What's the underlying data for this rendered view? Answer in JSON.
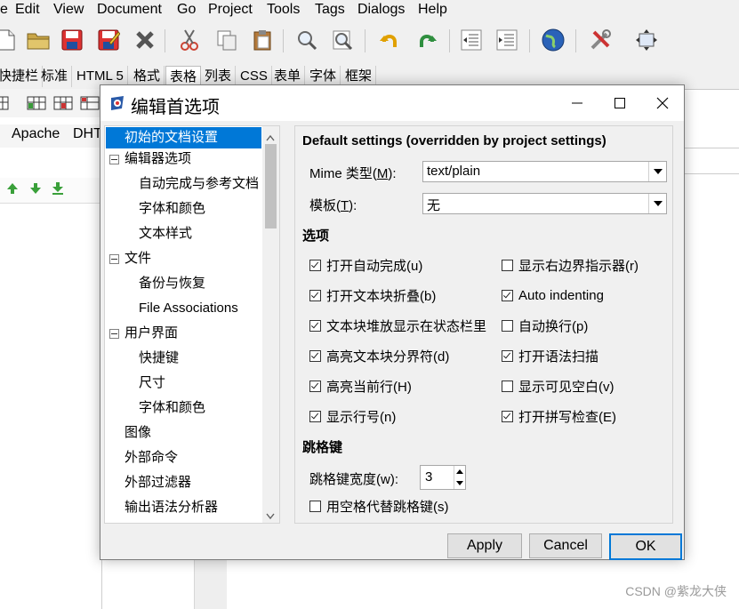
{
  "menubar": {
    "items": [
      "e",
      "Edit",
      "View",
      "Document",
      "Go",
      "Project",
      "Tools",
      "Tags",
      "Dialogs",
      "Help"
    ]
  },
  "toolbar_icons": [
    "new-file-icon",
    "open-folder-icon",
    "save-icon",
    "save-as-icon",
    "close-x-icon",
    "cut-icon",
    "copy-icon",
    "paste-icon",
    "find-icon",
    "find-replace-icon",
    "undo-icon",
    "redo-icon",
    "indent-left-icon",
    "indent-right-icon",
    "globe-preview-icon",
    "tools-icon",
    "fullscreen-icon"
  ],
  "app_tabs": [
    "快捷栏",
    "标准",
    "HTML 5",
    "格式",
    "表格",
    "列表",
    "CSS",
    "表单",
    "字体",
    "框架"
  ],
  "app_tab_active": 4,
  "app_strip_texts": [
    "Apache",
    "DHT"
  ],
  "dialog": {
    "title": "编辑首选项",
    "tree": [
      {
        "label": "初始的文档设置",
        "level": 0,
        "selected": true
      },
      {
        "label": "编辑器选项",
        "level": 0,
        "expander": true
      },
      {
        "label": "自动完成与参考文档",
        "level": 1
      },
      {
        "label": "字体和颜色",
        "level": 1
      },
      {
        "label": "文本样式",
        "level": 1
      },
      {
        "label": "文件",
        "level": 0,
        "expander": true
      },
      {
        "label": "备份与恢复",
        "level": 1
      },
      {
        "label": "File Associations",
        "level": 1
      },
      {
        "label": "用户界面",
        "level": 0,
        "expander": true
      },
      {
        "label": "快捷键",
        "level": 1
      },
      {
        "label": "尺寸",
        "level": 1
      },
      {
        "label": "字体和颜色",
        "level": 1
      },
      {
        "label": "图像",
        "level": 0
      },
      {
        "label": "外部命令",
        "level": 0
      },
      {
        "label": "外部过滤器",
        "level": 0
      },
      {
        "label": "输出语法分析器",
        "level": 0
      }
    ],
    "panel": {
      "default_title": "Default settings (overridden by project settings)",
      "mime_label": "Mime 类型(",
      "mime_key": "M",
      "mime_label_end": "):",
      "mime_value": "text/plain",
      "template_label": "模板(",
      "template_key": "T",
      "template_label_end": "):",
      "template_value": "无",
      "options_title": "选项",
      "options_left": [
        {
          "label": "打开自动完成(u)",
          "checked": true
        },
        {
          "label": "打开文本块折叠(b)",
          "checked": true
        },
        {
          "label": "文本块堆放显示在状态栏里",
          "checked": true
        },
        {
          "label": "高亮文本块分界符(d)",
          "checked": true
        },
        {
          "label": "高亮当前行(H)",
          "checked": true
        },
        {
          "label": "显示行号(n)",
          "checked": true
        }
      ],
      "options_right": [
        {
          "label": "显示右边界指示器(r)",
          "checked": false
        },
        {
          "label": "Auto indenting",
          "checked": true
        },
        {
          "label": "自动换行(p)",
          "checked": false
        },
        {
          "label": "打开语法扫描",
          "checked": true
        },
        {
          "label": "显示可见空白(v)",
          "checked": false
        },
        {
          "label": "打开拼写检查(E)",
          "checked": true
        }
      ],
      "tab_title": "跳格键",
      "tab_width_label": "跳格键宽度(w):",
      "tab_width_value": "3",
      "spaces_label": "用空格代替跳格键(s)",
      "spaces_checked": false
    },
    "buttons": {
      "apply": "Apply",
      "cancel": "Cancel",
      "ok": "OK"
    }
  },
  "watermark": "CSDN @紫龙大侠",
  "colors": {
    "selection": "#0078d7",
    "dialog_bg": "#f0f0f0"
  }
}
